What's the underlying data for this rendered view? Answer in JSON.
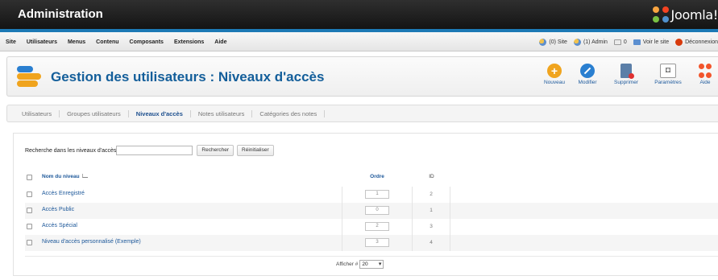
{
  "header": {
    "title": "Administration",
    "brand": "Joomla!"
  },
  "menu": {
    "items": [
      "Site",
      "Utilisateurs",
      "Menus",
      "Contenu",
      "Composants",
      "Extensions",
      "Aide"
    ]
  },
  "status": {
    "site_users": "(0) Site",
    "admin_users": "(1) Admin",
    "messages": "0",
    "view_site": "Voir le site",
    "logout": "Déconnexion"
  },
  "toolbar": {
    "page_title": "Gestion des utilisateurs : Niveaux d'accès",
    "buttons": {
      "new": "Nouveau",
      "edit": "Modifier",
      "delete": "Supprimer",
      "params": "Paramètres",
      "help": "Aide"
    }
  },
  "tabs": [
    "Utilisateurs",
    "Groupes utilisateurs",
    "Niveaux d'accès",
    "Notes utilisateurs",
    "Catégories des notes"
  ],
  "active_tab": "Niveaux d'accès",
  "filter": {
    "label": "Recherche dans les niveaux d'accès",
    "value": "",
    "search_button": "Rechercher",
    "reset_button": "Réinitialiser"
  },
  "table": {
    "columns": {
      "name": "Nom du niveau",
      "order": "Ordre",
      "id": "ID"
    },
    "rows": [
      {
        "name": "Accès Enregistré",
        "order": "1",
        "id": "2"
      },
      {
        "name": "Accès Public",
        "order": "0",
        "id": "1"
      },
      {
        "name": "Accès Spécial",
        "order": "2",
        "id": "3"
      },
      {
        "name": "Niveau d'accès personnalisé (Exemple)",
        "order": "3",
        "id": "4"
      }
    ]
  },
  "pagination": {
    "label": "Afficher #",
    "value": "20"
  },
  "colors": {
    "accent": "#1c79b5",
    "link": "#1c5799",
    "title": "#135e9a"
  }
}
